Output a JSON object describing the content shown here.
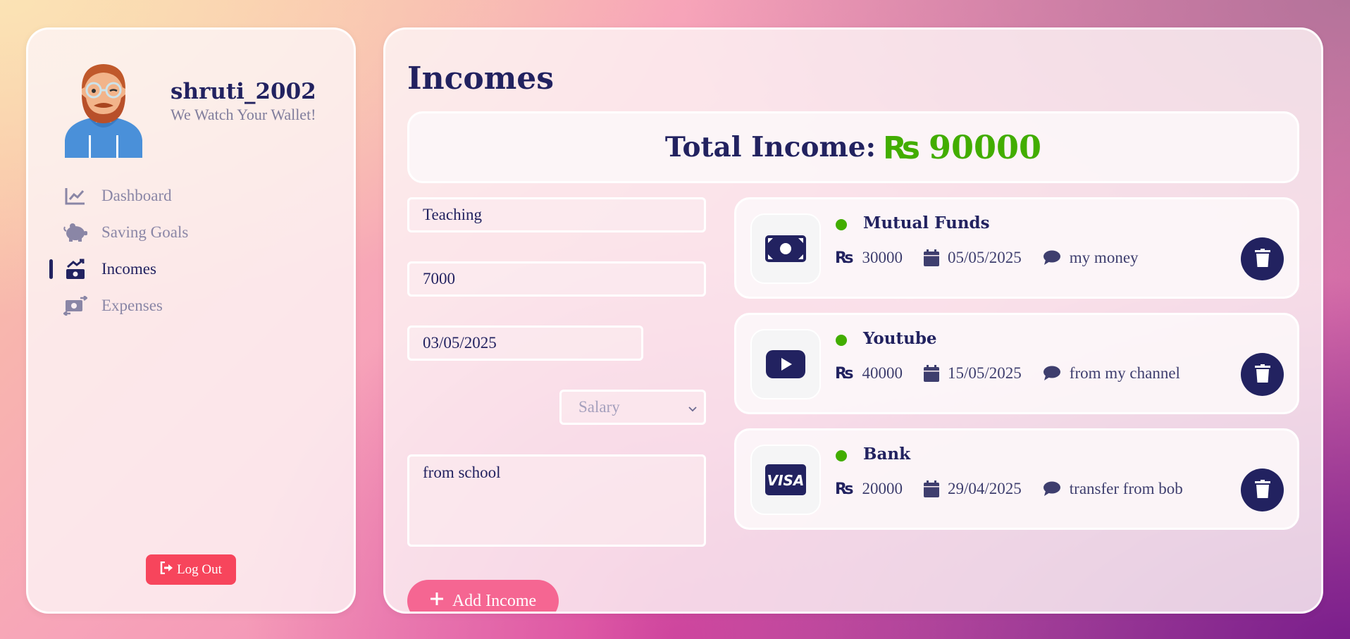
{
  "profile": {
    "username": "shruti_2002",
    "tagline": "We Watch Your Wallet!"
  },
  "nav": [
    {
      "label": "Dashboard",
      "icon": "chart-line-icon",
      "active": false
    },
    {
      "label": "Saving Goals",
      "icon": "piggy-bank-icon",
      "active": false
    },
    {
      "label": "Incomes",
      "icon": "money-trend-icon",
      "active": true
    },
    {
      "label": "Expenses",
      "icon": "money-transfer-icon",
      "active": false
    }
  ],
  "logout_label": "Log Out",
  "page": {
    "title": "Incomes",
    "total_label": "Total Income:",
    "currency": "₨",
    "total_value": "90000"
  },
  "form": {
    "title_value": "Teaching",
    "amount_value": "7000",
    "date_value": "03/05/2025",
    "category_value": "Salary",
    "description_value": "from school",
    "submit_label": "Add Income"
  },
  "incomes": [
    {
      "title": "Mutual Funds",
      "amount": "30000",
      "date": "05/05/2025",
      "note": "my money",
      "icon": "money-bill-icon"
    },
    {
      "title": "Youtube",
      "amount": "40000",
      "date": "15/05/2025",
      "note": "from my channel",
      "icon": "youtube-icon"
    },
    {
      "title": "Bank",
      "amount": "20000",
      "date": "29/04/2025",
      "note": "transfer from bob",
      "icon": "visa-card-icon"
    }
  ],
  "colors": {
    "navy": "#222260",
    "green": "#42ad00",
    "logout": "#f7455c",
    "add_button": "#f56692"
  }
}
